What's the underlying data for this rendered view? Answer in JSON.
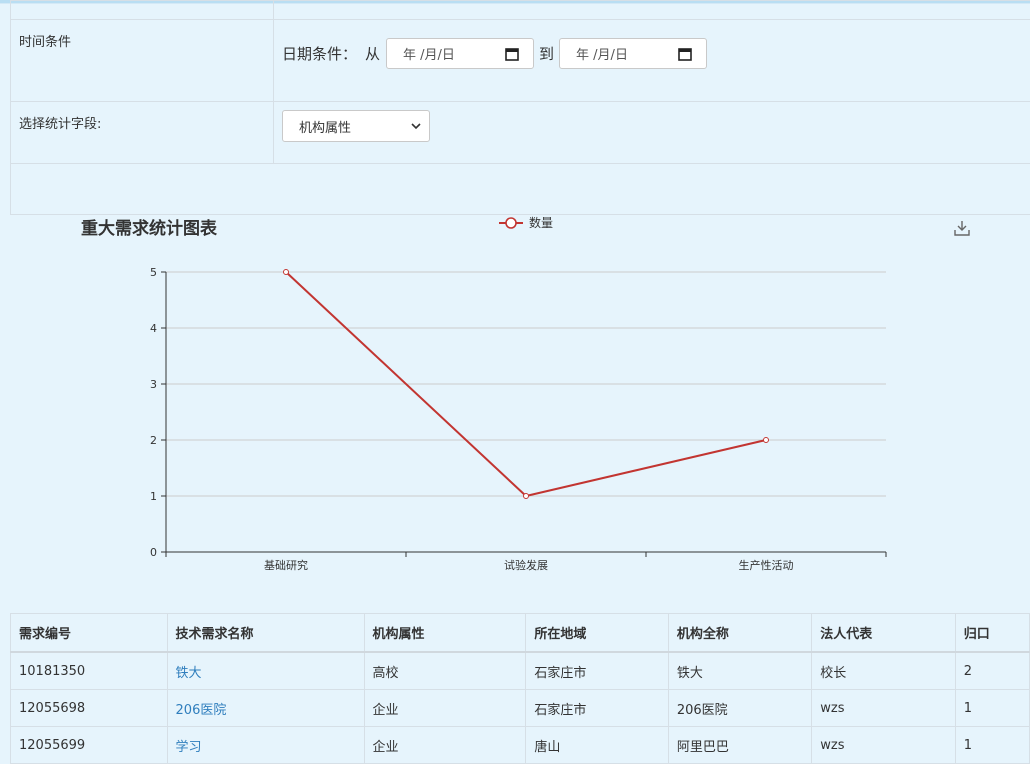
{
  "form": {
    "time_label": "时间条件",
    "date_prefix": "日期条件：",
    "from_text": "从",
    "to_text": "到",
    "date_from_placeholder": "年 /月/日",
    "date_to_placeholder": "年 /月/日",
    "field_label": "选择统计字段:",
    "field_selected": "机构属性"
  },
  "chart": {
    "title": "重大需求统计图表",
    "legend": "数量",
    "line_color": "#c23531",
    "axis_color": "#333333",
    "grid_color": "#cccccc"
  },
  "chart_data": {
    "type": "line",
    "title": "重大需求统计图表",
    "categories": [
      "基础研究",
      "试验发展",
      "生产性活动"
    ],
    "series": [
      {
        "name": "数量",
        "values": [
          5,
          1,
          2
        ]
      }
    ],
    "yticks": [
      "0",
      "1",
      "2",
      "3",
      "4",
      "5"
    ],
    "ylim": [
      0,
      5
    ],
    "grid": true,
    "legend_position": "top-center"
  },
  "table": {
    "headers": [
      "需求编号",
      "技术需求名称",
      "机构属性",
      "所在地域",
      "机构全称",
      "法人代表",
      "归口"
    ],
    "rows": [
      [
        "10181350",
        "铁大",
        "高校",
        "石家庄市",
        "铁大",
        "校长",
        "2"
      ],
      [
        "12055698",
        "206医院",
        "企业",
        "石家庄市",
        "206医院",
        "wzs",
        "1"
      ],
      [
        "12055699",
        "学习",
        "企业",
        "唐山",
        "阿里巴巴",
        "wzs",
        "1"
      ]
    ]
  }
}
